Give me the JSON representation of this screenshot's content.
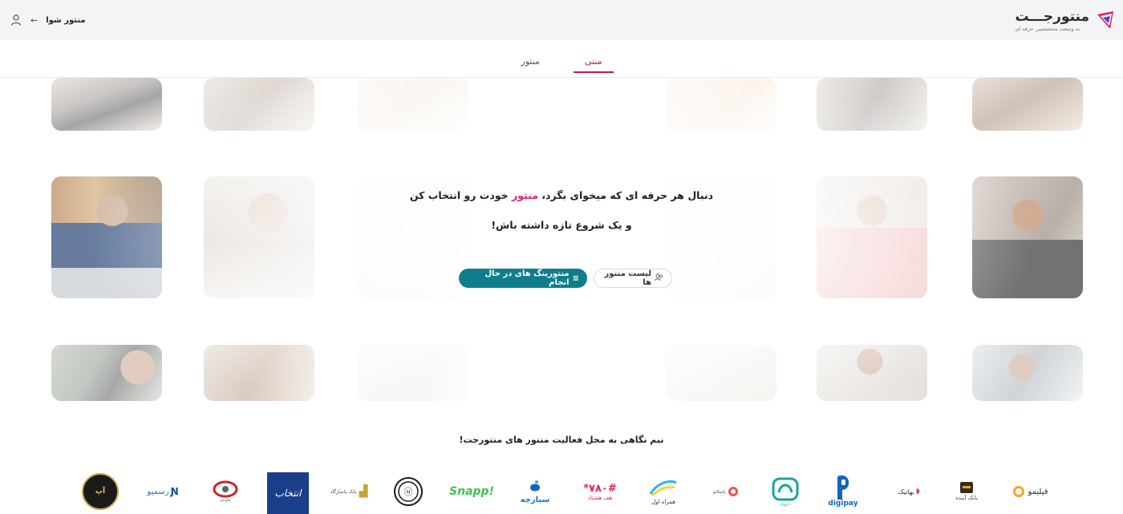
{
  "header": {
    "brand_name": "منتورجـــت",
    "brand_tagline": "به وسعت متخصصین حرفه ای",
    "login_label": "منتور شوا"
  },
  "tabs": [
    {
      "label": "منتی",
      "active": true
    },
    {
      "label": "منتور",
      "active": false
    }
  ],
  "hero": {
    "line1_before": "دنبال هر حرفه ای که میخوای بگرد، ",
    "line1_accent": "منتور",
    "line1_after": " خودت رو انتخاب کن",
    "line2": "و یک شروع تازه داشته باش!",
    "primary_button": "منتورینگ های در حال انجام",
    "secondary_button": "لیست منتور ها"
  },
  "partners": {
    "title": "نیم نگاهی به محل فعالیت منتور های منتورجت!",
    "logos": [
      {
        "name": "فیلیمو"
      },
      {
        "name": "بانک آینده"
      },
      {
        "name": "بهاتیک"
      },
      {
        "name": "digipay"
      },
      {
        "name": "دارویار"
      },
      {
        "name": "باسلام"
      },
      {
        "name": "همراه اول"
      },
      {
        "name": "هف هشتاد"
      },
      {
        "name": "سیارچه"
      },
      {
        "name": "Snapp!"
      },
      {
        "name": "بانک سپه"
      },
      {
        "name": "بانک پاسارگاد"
      },
      {
        "name": "انتخاب"
      },
      {
        "name": "هاوینو"
      },
      {
        "name": "رسمیو"
      },
      {
        "name": "آپ"
      }
    ]
  },
  "colors": {
    "accent": "#e0206b",
    "tab_active": "#c2185b",
    "primary_button": "#0f7d8c",
    "header_bg": "#f4f4f6"
  }
}
